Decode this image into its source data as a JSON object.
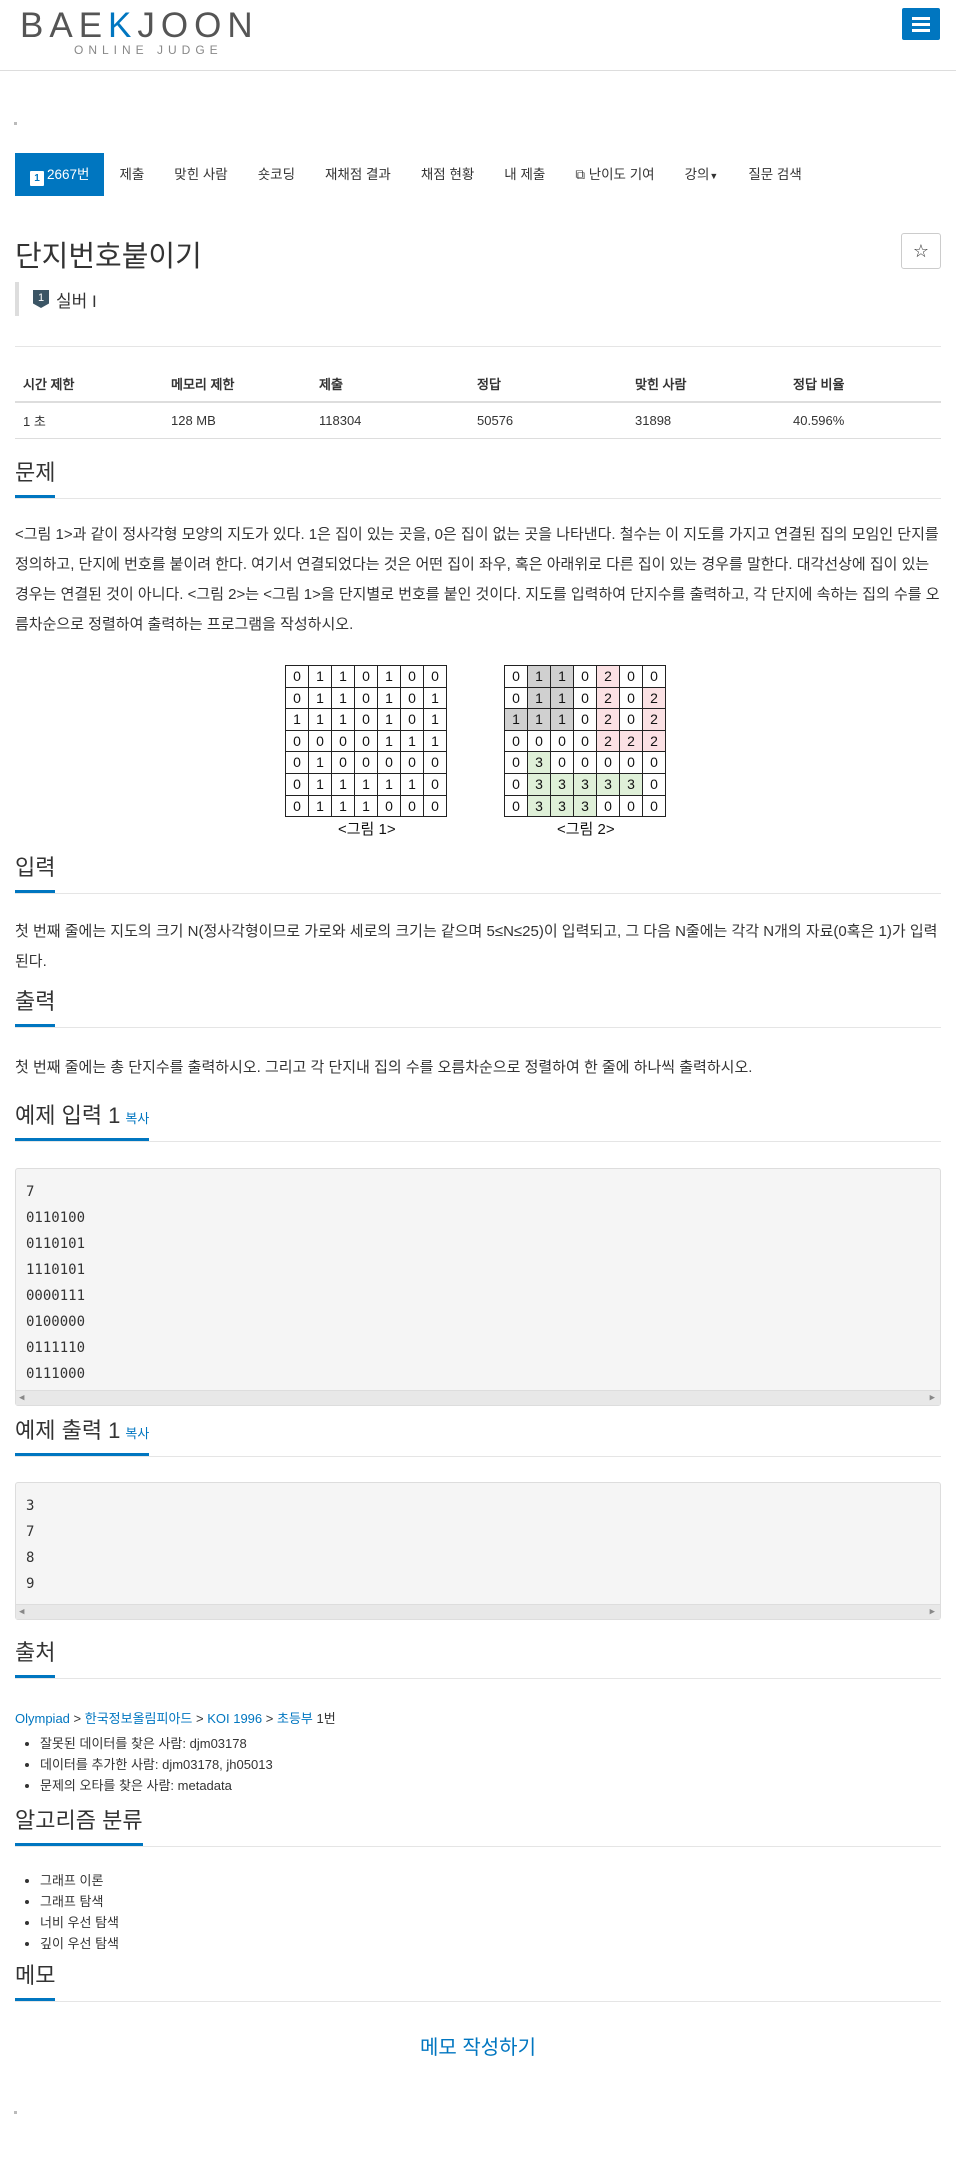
{
  "header": {
    "logo_main_left": "BAE",
    "logo_main_mark": "K",
    "logo_main_right": "JOON",
    "logo_sub": "ONLINE JUDGE",
    "menu_icon": "hamburger-menu-icon",
    "accent_color": "#0076c0"
  },
  "nav": {
    "active_badge": "1",
    "items": [
      "2667번",
      "제출",
      "맞힌 사람",
      "숏코딩",
      "재채점 결과",
      "채점 현황",
      "내 제출",
      "난이도 기여",
      "강의",
      "질문 검색"
    ]
  },
  "problem": {
    "title": "단지번호붙이기",
    "star": "☆",
    "tier_badge": "1",
    "tier": "실버 I"
  },
  "stats": {
    "headers": [
      "시간 제한",
      "메모리 제한",
      "제출",
      "정답",
      "맞힌 사람",
      "정답 비율"
    ],
    "values": [
      "1 초",
      "128 MB",
      "118304",
      "50576",
      "31898",
      "40.596%"
    ]
  },
  "sections": {
    "problem": "문제",
    "input": "입력",
    "output": "출력",
    "sample_input": "예제 입력 1",
    "sample_output": "예제 출력 1",
    "copy": "복사",
    "source": "출처",
    "algorithm": "알고리즘 분류",
    "memo": "메모"
  },
  "problem_text": "<그림 1>과 같이 정사각형 모양의 지도가 있다. 1은 집이 있는 곳을, 0은 집이 없는 곳을 나타낸다. 철수는 이 지도를 가지고 연결된 집의 모임인 단지를 정의하고, 단지에 번호를 붙이려 한다. 여기서 연결되었다는 것은 어떤 집이 좌우, 혹은 아래위로 다른 집이 있는 경우를 말한다. 대각선상에 집이 있는 경우는 연결된 것이 아니다. <그림 2>는 <그림 1>을 단지별로 번호를 붙인 것이다. 지도를 입력하여 단지수를 출력하고, 각 단지에 속하는 집의 수를 오름차순으로 정렬하여 출력하는 프로그램을 작성하시오.",
  "figures": {
    "fig1_caption": "<그림 1>",
    "fig2_caption": "<그림 2>",
    "fig1": [
      "0110100",
      "0110101",
      "1110101",
      "0000111",
      "0100000",
      "0111110",
      "0111000"
    ],
    "fig2": [
      "0110200",
      "0110202",
      "1110202",
      "0000222",
      "0300000",
      "0333330",
      "0333000"
    ],
    "colors": {
      "1": "#d0d0d0",
      "2": "#fbe1e4",
      "3": "#dff0d8"
    }
  },
  "input_text": "첫 번째 줄에는 지도의 크기 N(정사각형이므로 가로와 세로의 크기는 같으며 5≤N≤25)이 입력되고, 그 다음 N줄에는 각각 N개의 자료(0혹은 1)가 입력된다.",
  "output_text": "첫 번째 줄에는 총 단지수를 출력하시오. 그리고 각 단지내 집의 수를 오름차순으로 정렬하여 한 줄에 하나씩 출력하시오.",
  "sample_input_lines": [
    "7",
    "0110100",
    "0110101",
    "1110101",
    "0000111",
    "0100000",
    "0111110",
    "0111000"
  ],
  "sample_output_lines": [
    "3",
    "7",
    "8",
    "9"
  ],
  "source": {
    "path": [
      "Olympiad",
      "한국정보올림피아드",
      "KOI 1996",
      "초등부"
    ],
    "sep": " > ",
    "suffix": " 1번",
    "credits": [
      "잘못된 데이터를 찾은 사람: djm03178",
      "데이터를 추가한 사람: djm03178, jh05013",
      "문제의 오타를 찾은 사람: metadata"
    ]
  },
  "algorithms": [
    "그래프 이론",
    "그래프 탐색",
    "너비 우선 탐색",
    "깊이 우선 탐색"
  ],
  "memo_button": "메모 작성하기"
}
